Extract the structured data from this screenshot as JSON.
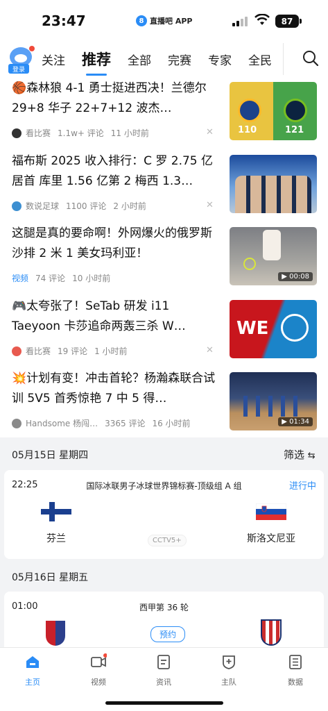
{
  "status_bar": {
    "time": "23:47",
    "app_label": "直播吧 APP",
    "battery": "87"
  },
  "nav": {
    "login_badge": "登录",
    "tabs": [
      "关注",
      "推荐",
      "全部",
      "完赛",
      "专家",
      "全民"
    ],
    "active_tab": "推荐"
  },
  "news": [
    {
      "title": "🏀森林狼 4-1 勇士挺进西决！兰德尔 29+8 华子 22+7+12 波杰…",
      "source": "看比赛",
      "comments": "1.1w+ 评论",
      "time": "11 小时前",
      "thumb_score_left": "110",
      "thumb_score_right": "121"
    },
    {
      "title": "福布斯 2025 收入排行：C 罗 2.75 亿居首 库里 1.56 亿第 2 梅西 1.3…",
      "source": "数说足球",
      "comments": "1100 评论",
      "time": "2 小时前"
    },
    {
      "title": "这腿是真的要命啊！外网爆火的俄罗斯沙排 2 米 1 美女玛利亚！",
      "source": "视频",
      "comments": "74 评论",
      "time": "10 小时前",
      "duration": "00:08"
    },
    {
      "title": "🎮太夸张了！SeTab 研发 i11 Taeyoon 卡莎追命两轰三杀 W…",
      "source": "看比赛",
      "comments": "19 评论",
      "time": "1 小时前"
    },
    {
      "title": "💥计划有变！冲击首轮？杨瀚森联合试训 5V5 首秀惊艳 7 中 5 得…",
      "source": "Handsome 杨闯…",
      "comments": "3365 评论",
      "time": "16 小时前",
      "duration": "01:34"
    }
  ],
  "schedule": {
    "filter_label": "筛选",
    "day1": {
      "date": "05月15日 星期四",
      "match": {
        "time": "22:25",
        "league": "国际冰联男子冰球世界锦标赛-顶级组 A 组",
        "status": "进行中",
        "home": "芬兰",
        "away": "斯洛文尼亚",
        "channel": "CCTV5+"
      }
    },
    "day2": {
      "date": "05月16日 星期五",
      "match": {
        "time": "01:00",
        "league": "西甲第 36 轮",
        "button": "预约"
      }
    }
  },
  "bottom_tabs": [
    "主页",
    "视频",
    "资讯",
    "主队",
    "数据"
  ],
  "colors": {
    "accent": "#2a8cf6",
    "badge_red": "#f04a3a"
  }
}
